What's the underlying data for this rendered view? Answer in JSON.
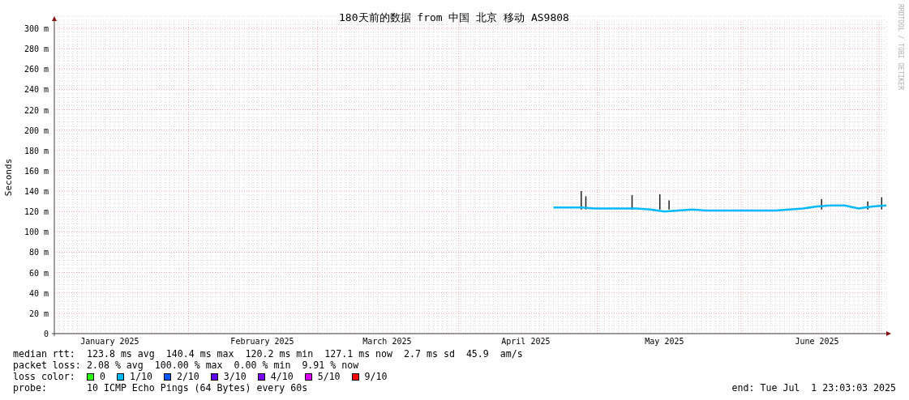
{
  "chart": {
    "chart_data": {
      "type": "line",
      "grid": true,
      "title": "180天前的数据 from 中国 北京 移动 AS9808",
      "ylabel": "Seconds",
      "ylim": [
        0,
        300
      ],
      "yticks": [
        {
          "value": 0,
          "label": "0"
        },
        {
          "value": 20,
          "label": "20 m"
        },
        {
          "value": 40,
          "label": "40 m"
        },
        {
          "value": 60,
          "label": "60 m"
        },
        {
          "value": 80,
          "label": "80 m"
        },
        {
          "value": 100,
          "label": "100 m"
        },
        {
          "value": 120,
          "label": "120 m"
        },
        {
          "value": 140,
          "label": "140 m"
        },
        {
          "value": 160,
          "label": "160 m"
        },
        {
          "value": 180,
          "label": "180 m"
        },
        {
          "value": 200,
          "label": "200 m"
        },
        {
          "value": 220,
          "label": "220 m"
        },
        {
          "value": 240,
          "label": "240 m"
        },
        {
          "value": 260,
          "label": "260 m"
        },
        {
          "value": 280,
          "label": "280 m"
        },
        {
          "value": 300,
          "label": "300 m"
        }
      ],
      "categories": [
        null,
        null,
        null,
        null,
        "January 2025",
        null,
        null,
        null,
        null,
        null,
        null,
        null,
        null,
        null,
        null,
        "February 2025",
        null,
        null,
        null,
        null,
        null,
        null,
        null,
        null,
        "March 2025",
        null,
        null,
        null,
        null,
        null,
        null,
        null,
        null,
        null,
        "April 2025",
        null,
        null,
        null,
        null,
        null,
        null,
        null,
        null,
        null,
        "May 2025",
        null,
        null,
        null,
        null,
        null,
        null,
        null,
        null,
        null,
        null,
        "June 2025",
        null,
        null,
        null,
        null,
        null
      ],
      "series": [
        {
          "name": "median rtt:",
          "color": "#00b8ff",
          "values": [
            null,
            null,
            null,
            null,
            null,
            null,
            null,
            null,
            null,
            null,
            null,
            null,
            null,
            null,
            null,
            null,
            null,
            null,
            null,
            null,
            null,
            null,
            null,
            null,
            null,
            null,
            null,
            null,
            null,
            null,
            null,
            null,
            null,
            null,
            null,
            null,
            124,
            124,
            124,
            123,
            123,
            123,
            123,
            122,
            120,
            121,
            122,
            121,
            121,
            121,
            121,
            121,
            121,
            122,
            123,
            125,
            126,
            126,
            123,
            125,
            126
          ]
        }
      ]
    },
    "credit": "RRDTOOL / TOBI OETIKER"
  },
  "legend": {
    "rows": [
      {
        "items": [
          "123.8 ms avg",
          "140.4 ms max",
          "120.2 ms min",
          "127.1 ms now",
          "2.7 ms sd",
          "45.9",
          "am/s"
        ]
      },
      {
        "label": "packet loss:",
        "items": [
          "2.08 % avg",
          "100.00 % max",
          "0.00 % min",
          "9.91 % now"
        ]
      }
    ],
    "loss_label": "loss color:",
    "loss_colors": [
      {
        "label": "0",
        "color": "#26ff00"
      },
      {
        "label": "1/10",
        "color": "#00b8ff"
      },
      {
        "label": "2/10",
        "color": "#0059ff"
      },
      {
        "label": "3/10",
        "color": "#5e00ff"
      },
      {
        "label": "4/10",
        "color": "#7e00ff"
      },
      {
        "label": "5/10",
        "color": "#dd00ff"
      },
      {
        "label": "9/10",
        "color": "#ff0000"
      }
    ],
    "probe_label": "probe:",
    "probe": "10 ICMP Echo Pings (64 Bytes) every 60s",
    "end": "end: Tue Jul  1 23:03:03 2025"
  }
}
